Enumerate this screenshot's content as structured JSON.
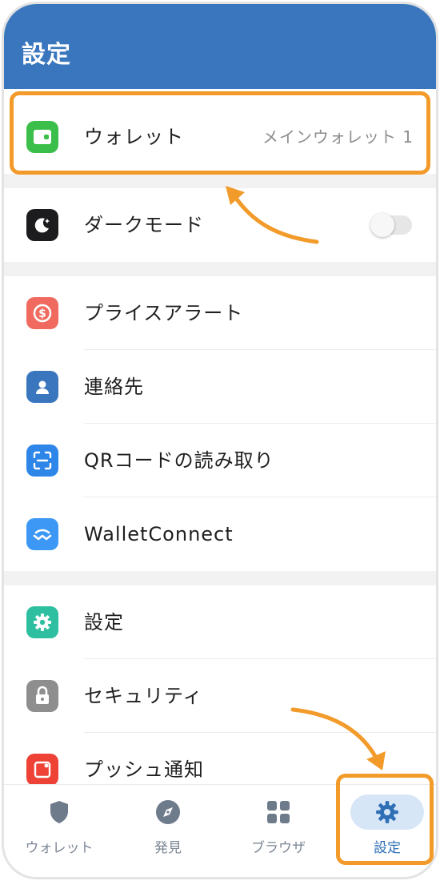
{
  "header": {
    "title": "設定"
  },
  "rows": {
    "wallet": {
      "label": "ウォレット",
      "value": "メインウォレット 1"
    },
    "dark_mode": {
      "label": "ダークモード",
      "toggle": "off"
    },
    "price_alert": {
      "label": "プライスアラート"
    },
    "contacts": {
      "label": "連絡先"
    },
    "qr_scan": {
      "label": "QRコードの読み取り"
    },
    "walletconnect": {
      "label": "WalletConnect"
    },
    "settings": {
      "label": "設定"
    },
    "security": {
      "label": "セキュリティ"
    },
    "push": {
      "label": "プッシュ通知"
    }
  },
  "tabbar": {
    "tabs": [
      {
        "label": "ウォレット",
        "icon": "shield-icon"
      },
      {
        "label": "発見",
        "icon": "compass-icon"
      },
      {
        "label": "ブラウザ",
        "icon": "grid-icon"
      },
      {
        "label": "設定",
        "icon": "gear-icon",
        "active": true
      }
    ]
  },
  "colors": {
    "header": "#3a76bd",
    "highlight": "#f29b2a",
    "active_tab": "#2e6fb6"
  }
}
